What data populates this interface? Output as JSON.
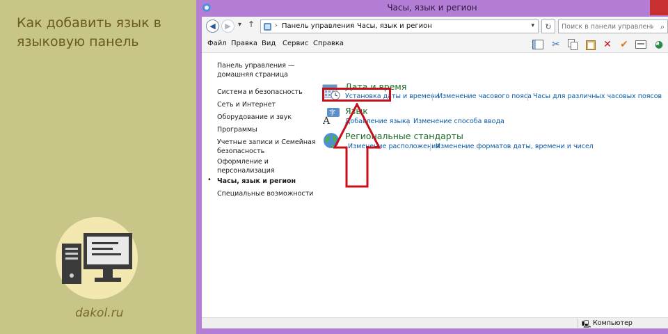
{
  "article": {
    "title": "Как добавить язык в языковую панель",
    "site": "dakol.ru"
  },
  "window": {
    "title": "Часы, язык и регион"
  },
  "address": {
    "crumbs": [
      "Панель управления",
      "Часы, язык и регион"
    ],
    "search_placeholder": "Поиск в панели управления"
  },
  "menu": [
    "Файл",
    "Правка",
    "Вид",
    "Сервис",
    "Справка"
  ],
  "sidebar": {
    "items": [
      "Панель управления — домашняя страница",
      "Система и безопасность",
      "Сеть и Интернет",
      "Оборудование и звук",
      "Программы",
      "Учетные записи и Семейная безопасность",
      "Оформление и персонализация",
      "Часы, язык и регион",
      "Специальные возможности"
    ],
    "active_index": 7
  },
  "categories": [
    {
      "title": "Дата и время",
      "links": [
        "Установка даты и времени",
        "Изменение часового пояса",
        "Часы для различных часовых поясов"
      ]
    },
    {
      "title": "Язык",
      "links": [
        "Добавление языка",
        "Изменение способа ввода"
      ]
    },
    {
      "title": "Региональные стандарты",
      "links": [
        "Изменение расположения",
        "Изменение форматов даты, времени и чисел"
      ]
    }
  ],
  "status": {
    "text": "Компьютер"
  },
  "colors": {
    "window_frame": "#b57ed6",
    "category_title": "#1e6b26",
    "link": "#0b5aa6",
    "highlight": "#c4101a"
  }
}
